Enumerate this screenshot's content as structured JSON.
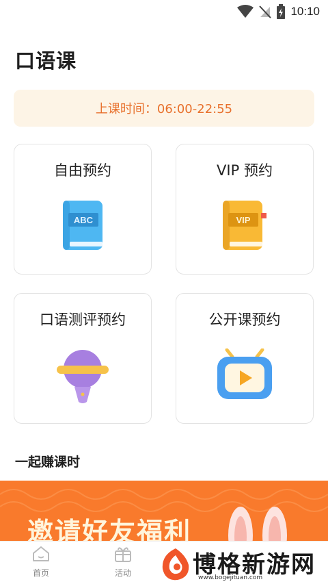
{
  "status_bar": {
    "time": "10:10"
  },
  "title": "口语课",
  "schedule": {
    "text": "上课时间：06:00-22:55"
  },
  "cards": [
    {
      "label": "自由预约",
      "icon": "abc-book-icon",
      "badge": "ABC"
    },
    {
      "label": "VIP 预约",
      "icon": "vip-book-icon",
      "badge": "VIP"
    },
    {
      "label": "口语测评预约",
      "icon": "microphone-icon"
    },
    {
      "label": "公开课预约",
      "icon": "tv-play-icon"
    }
  ],
  "section": {
    "title": "一起赚课时"
  },
  "promo": {
    "text": "邀请好友福利"
  },
  "nav": [
    {
      "label": "首页",
      "icon": "home-icon"
    },
    {
      "label": "活动",
      "icon": "gift-icon"
    }
  ],
  "watermark": {
    "text": "博格新游网",
    "url": "www.bogejituan.com"
  },
  "colors": {
    "accent": "#e8712d",
    "banner_bg": "#fdf4e6",
    "promo_bg": "#f97a2c"
  }
}
